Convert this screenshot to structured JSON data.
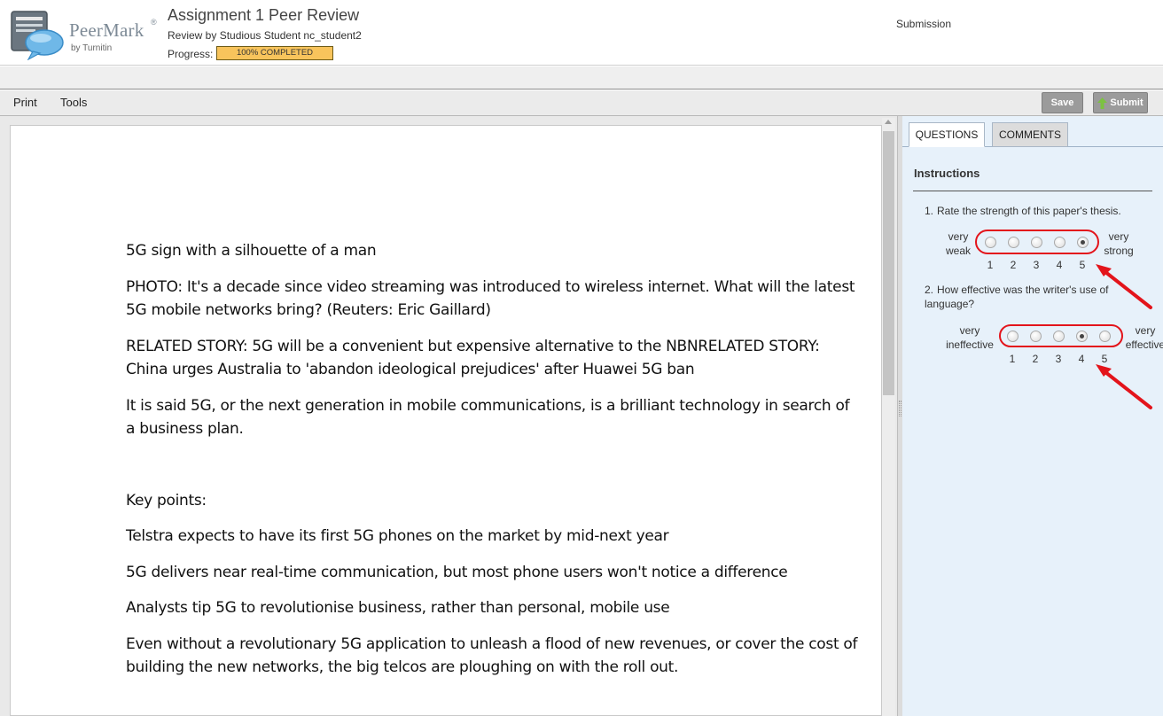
{
  "header": {
    "logo_name": "PeerMark",
    "logo_reg": "®",
    "logo_by": "by Turnitin",
    "title": "Assignment 1 Peer Review",
    "subtitle": "Review by Studious Student nc_student2",
    "progress_label": "Progress:",
    "progress_value": 1.0,
    "progress_text": "100% COMPLETED",
    "submission_label": "Submission"
  },
  "toolbar": {
    "print_label": "Print",
    "tools_label": "Tools",
    "save_label": "Save",
    "submit_label": "Submit"
  },
  "document": {
    "paragraphs": [
      "5G sign with a silhouette of a man",
      "PHOTO: It's a decade since video streaming was introduced to wireless internet. What will the latest 5G mobile networks bring? (Reuters: Eric Gaillard)",
      "RELATED STORY: 5G will be a convenient but expensive alternative to the NBNRELATED STORY: China urges Australia to 'abandon ideological prejudices' after Huawei 5G ban",
      "It is said 5G, or the next generation in mobile communications, is a brilliant technology in search of a business plan.",
      "Key points:",
      "Telstra expects to have its first 5G phones on the market by mid-next year",
      "5G delivers near real-time communication, but most phone users won't notice a difference",
      "Analysts tip 5G to revolutionise business, rather than personal, mobile use",
      "Even without a revolutionary 5G application to unleash a flood of new revenues, or cover the cost of building the new networks, the big telcos are ploughing on with the roll out."
    ]
  },
  "panel": {
    "tabs": [
      {
        "label": "QUESTIONS",
        "active": true
      },
      {
        "label": "COMMENTS",
        "active": false
      }
    ],
    "instructions_label": "Instructions",
    "questions": [
      {
        "number": "1.",
        "text": "Rate the strength of this paper's thesis.",
        "low_label_1": "very",
        "low_label_2": "weak",
        "high_label_1": "very",
        "high_label_2": "strong",
        "options": [
          "1",
          "2",
          "3",
          "4",
          "5"
        ],
        "selected": "5"
      },
      {
        "number": "2.",
        "text": "How effective was the writer's use of language?",
        "low_label_1": "very",
        "low_label_2": "ineffective",
        "high_label_1": "very",
        "high_label_2": "effective",
        "options": [
          "1",
          "2",
          "3",
          "4",
          "5"
        ],
        "selected": "4"
      }
    ]
  },
  "colors": {
    "progress_fill": "#f8c45c",
    "panel_bg": "#e7f1fa",
    "annotation_red": "#e3141b",
    "button_gray": "#9b9b9b",
    "submit_arrow_green": "#7cc242"
  },
  "icons": [
    "peermark-logo-icon",
    "submit-arrow-icon",
    "scroll-up-icon",
    "annotation-arrow-icon"
  ]
}
